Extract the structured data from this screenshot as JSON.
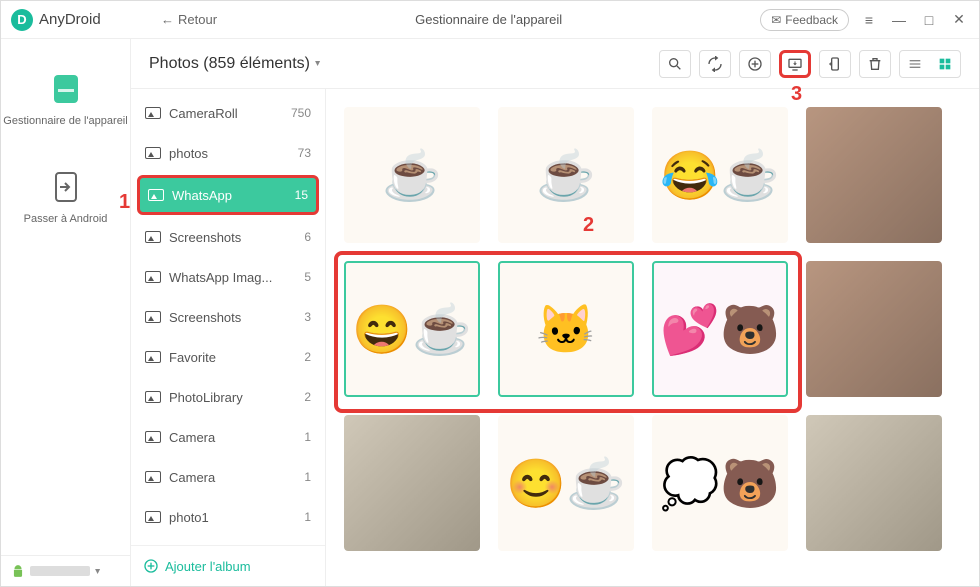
{
  "app": {
    "name": "AnyDroid",
    "logo_letter": "D"
  },
  "titlebar": {
    "back": "Retour",
    "center": "Gestionnaire de l'appareil",
    "feedback": "Feedback"
  },
  "leftbar": {
    "items": [
      {
        "label": "Gestionnaire de l'appareil"
      },
      {
        "label": "Passer à Android"
      }
    ],
    "device": "······"
  },
  "section": {
    "title": "Photos (859 éléments)"
  },
  "albums": [
    {
      "name": "CameraRoll",
      "count": "750"
    },
    {
      "name": "photos",
      "count": "73"
    },
    {
      "name": "WhatsApp",
      "count": "15",
      "selected": true
    },
    {
      "name": "Screenshots",
      "count": "6"
    },
    {
      "name": "WhatsApp Imag...",
      "count": "5"
    },
    {
      "name": "Screenshots",
      "count": "3"
    },
    {
      "name": "Favorite",
      "count": "2"
    },
    {
      "name": "PhotoLibrary",
      "count": "2"
    },
    {
      "name": "Camera",
      "count": "1"
    },
    {
      "name": "Camera",
      "count": "1"
    },
    {
      "name": "photo1",
      "count": "1"
    }
  ],
  "add_album": "Ajouter l'album",
  "annotations": {
    "a1": "1",
    "a2": "2",
    "a3": "3"
  },
  "thumbs": {
    "row1": [
      "☕",
      "☕",
      "☕",
      "photo"
    ],
    "row2": [
      "☕",
      "🐱",
      "🐻",
      "photo"
    ],
    "row3": [
      "photo",
      "☕",
      "🐻",
      "photo"
    ]
  }
}
